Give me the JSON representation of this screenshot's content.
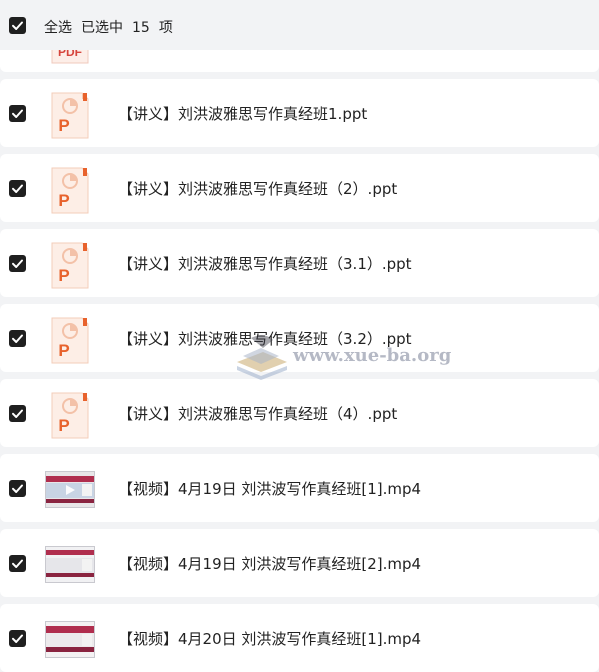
{
  "header": {
    "select_all_label": "全选",
    "selected_prefix": "已选中",
    "selected_count": "15",
    "selected_suffix": "项"
  },
  "files": [
    {
      "name": "",
      "type": "pdf",
      "icon": "pdf-file-icon"
    },
    {
      "name": "【讲义】刘洪波雅思写作真经班1.ppt",
      "type": "ppt",
      "icon": "ppt-file-icon"
    },
    {
      "name": "【讲义】刘洪波雅思写作真经班（2）.ppt",
      "type": "ppt",
      "icon": "ppt-file-icon"
    },
    {
      "name": "【讲义】刘洪波雅思写作真经班（3.1）.ppt",
      "type": "ppt",
      "icon": "ppt-file-icon"
    },
    {
      "name": "【讲义】刘洪波雅思写作真经班（3.2）.ppt",
      "type": "ppt",
      "icon": "ppt-file-icon"
    },
    {
      "name": "【讲义】刘洪波雅思写作真经班（4）.ppt",
      "type": "ppt",
      "icon": "ppt-file-icon"
    },
    {
      "name": "【视频】4月19日 刘洪波写作真经班[1].mp4",
      "type": "video",
      "icon": "video-thumbnail"
    },
    {
      "name": "【视频】4月19日 刘洪波写作真经班[2].mp4",
      "type": "video",
      "icon": "video-thumbnail"
    },
    {
      "name": "【视频】4月20日 刘洪波写作真经班[1].mp4",
      "type": "video",
      "icon": "video-thumbnail"
    }
  ],
  "watermark": {
    "text": "www.xue-ba.org"
  },
  "colors": {
    "background": "#f2f3f5",
    "row": "#ffffff",
    "checkbox": "#1f1f1f",
    "ppt_orange": "#e8622c",
    "ppt_bg": "#fdeee6"
  }
}
